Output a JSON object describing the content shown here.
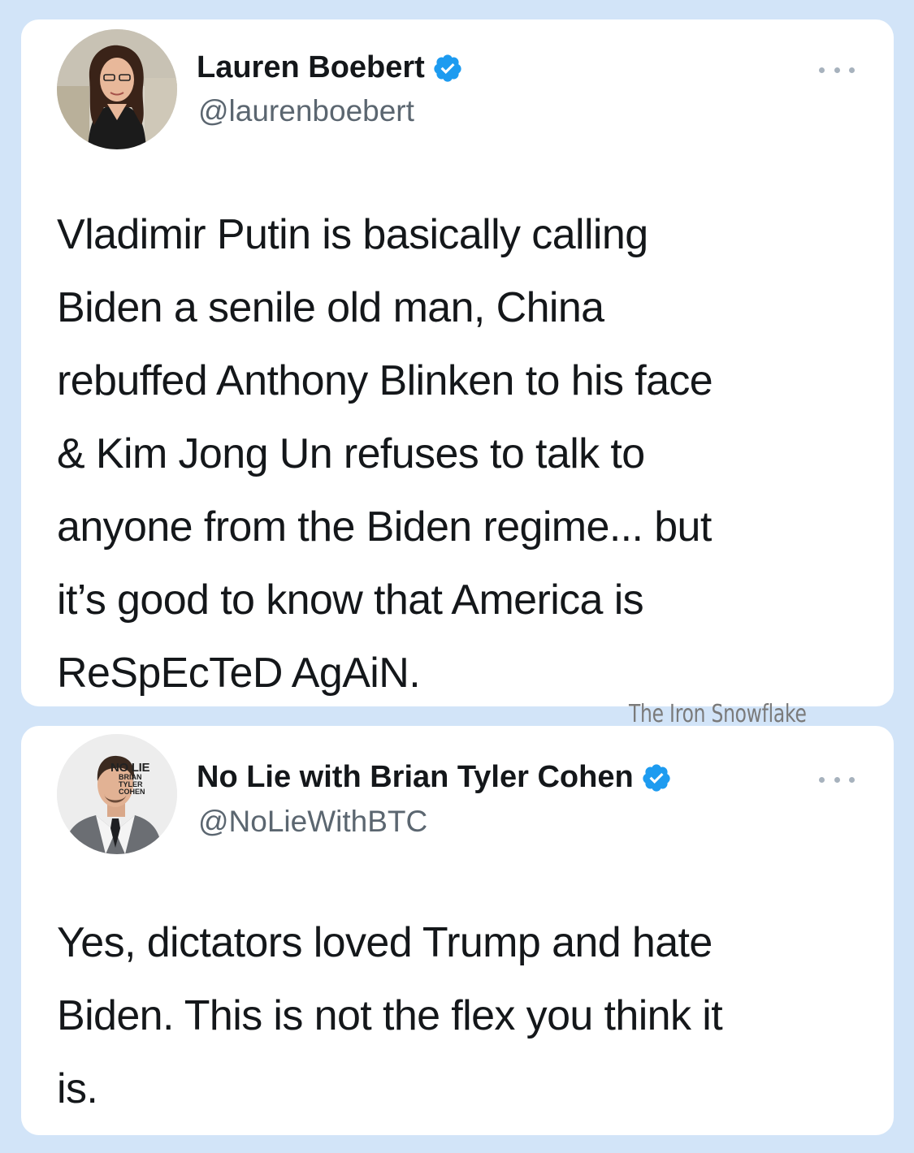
{
  "tweets": [
    {
      "author_name": "Lauren Boebert",
      "handle": "@laurenboebert",
      "verified": true,
      "avatar_icon": "profile-photo",
      "lines": [
        "Vladimir Putin is basically calling",
        "Biden a senile old man, China",
        "rebuffed Anthony Blinken to his face",
        "& Kim Jong Un refuses to talk to",
        "anyone from the Biden regime... but",
        "it’s good to know that America is",
        "ReSpEcTeD AgAiN."
      ]
    },
    {
      "author_name": "No Lie with Brian Tyler Cohen",
      "handle": "@NoLieWithBTC",
      "verified": true,
      "avatar_icon": "profile-photo",
      "avatar_logo": {
        "line1": "NO LIE",
        "line2": "BRIAN",
        "line3": "TYLER",
        "line4": "COHEN"
      },
      "lines": [
        "Yes, dictators loved Trump and hate",
        "Biden. This is not the flex you think it",
        "is."
      ]
    }
  ],
  "watermark": "The Iron Snowflake",
  "colors": {
    "background": "#d2e4f8",
    "card": "#ffffff",
    "verified_badge": "#1d9bf0",
    "text": "#14171a",
    "secondary_text": "#5b6670"
  }
}
